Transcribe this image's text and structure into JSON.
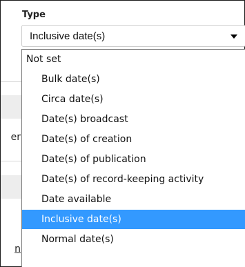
{
  "background": {
    "text_fragment_1": "er",
    "text_fragment_2": "n"
  },
  "field": {
    "label": "Type",
    "selected_value": "Inclusive date(s)"
  },
  "options": [
    {
      "label": "Not set",
      "level": 0,
      "selected": false
    },
    {
      "label": "Bulk date(s)",
      "level": 1,
      "selected": false
    },
    {
      "label": "Circa date(s)",
      "level": 1,
      "selected": false
    },
    {
      "label": "Date(s) broadcast",
      "level": 1,
      "selected": false
    },
    {
      "label": "Date(s) of creation",
      "level": 1,
      "selected": false
    },
    {
      "label": "Date(s) of publication",
      "level": 1,
      "selected": false
    },
    {
      "label": "Date(s) of record-keeping activity",
      "level": 1,
      "selected": false
    },
    {
      "label": "Date available",
      "level": 1,
      "selected": false
    },
    {
      "label": "Inclusive date(s)",
      "level": 1,
      "selected": true
    },
    {
      "label": "Normal date(s)",
      "level": 1,
      "selected": false
    }
  ],
  "colors": {
    "selection": "#3399ff",
    "selection_text": "#ffffff"
  }
}
